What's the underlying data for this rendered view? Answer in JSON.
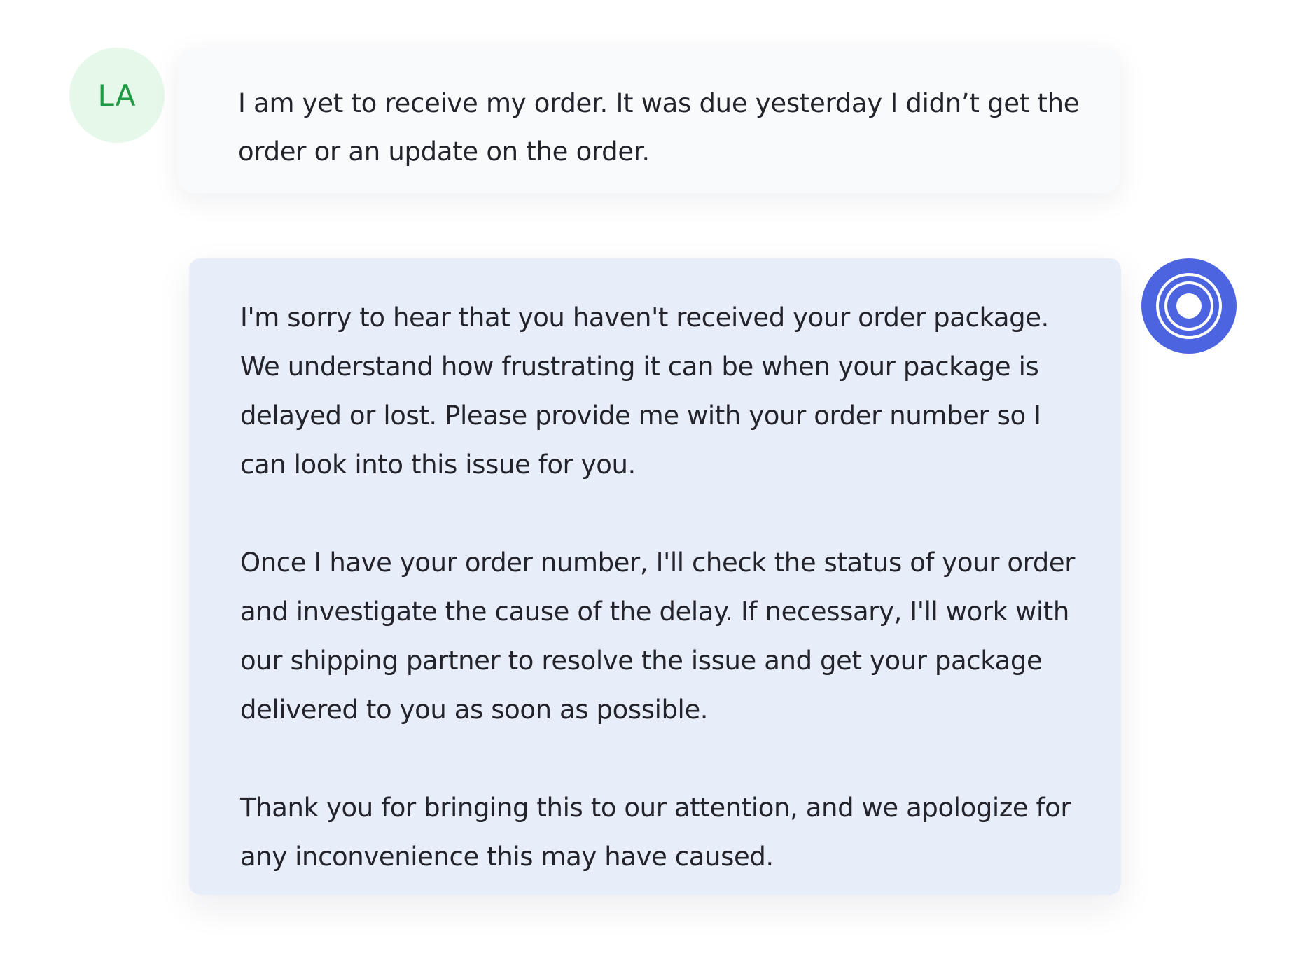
{
  "colors": {
    "user_avatar_bg": "#e6f8ea",
    "user_avatar_text": "#1f9a43",
    "bot_avatar_bg": "#4d64e0",
    "user_bubble_bg": "#f9fafb",
    "bot_bubble_bg": "#e8eef9",
    "text": "#23232b"
  },
  "user": {
    "initials": "LA",
    "message": "I am yet to receive my order. It was due yesterday I didn’t get the order or an update on the order."
  },
  "bot": {
    "avatar_icon": "concentric-rings-icon",
    "paragraphs": [
      "I'm sorry to hear that you haven't received your order package. We understand how frustrating it can be when your package is delayed or lost. Please provide me with your order number so I can look into this issue for you.",
      "Once I have your order number, I'll check the status of your order and investigate the cause of the delay. If necessary, I'll work with our shipping partner to resolve the issue and get your package delivered to you as soon as possible.",
      "Thank you for bringing this to our attention, and we apologize for any inconvenience this may have caused."
    ]
  }
}
